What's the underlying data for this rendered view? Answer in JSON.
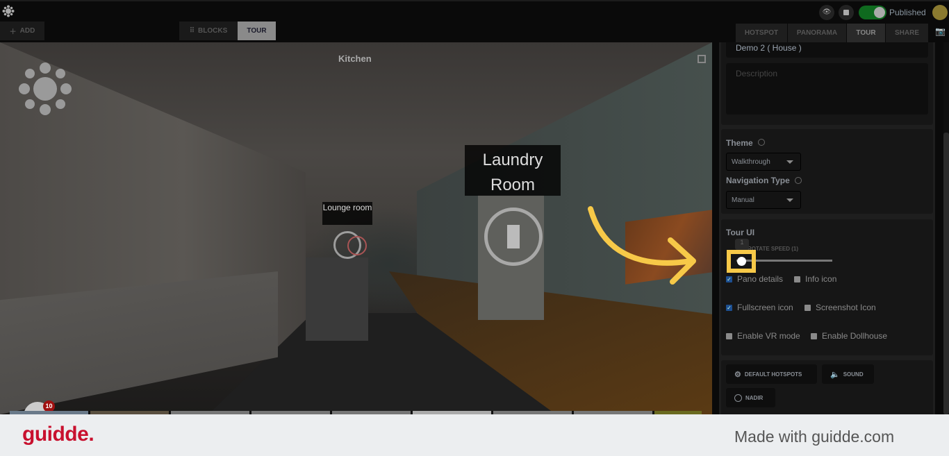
{
  "topbar": {
    "status_label": "Published",
    "toggle_on": true,
    "accent": "#0f6a1f"
  },
  "toolbar": {
    "add_label": "ADD",
    "blocks_label": "BLOCKS",
    "tour_label": "TOUR"
  },
  "right_tabs": [
    {
      "label": "HOTSPOT"
    },
    {
      "label": "PANORAMA"
    },
    {
      "label": "TOUR",
      "active": true
    },
    {
      "label": "SHARE"
    }
  ],
  "pano": {
    "title": "Kitchen",
    "hotspots": [
      {
        "label": "Lounge room"
      },
      {
        "label": "Laundry Room"
      }
    ],
    "badge": "10"
  },
  "panel": {
    "tour_name": "Demo 2 ( House )",
    "description_placeholder": "Description",
    "theme_label": "Theme",
    "theme_value": "Walkthrough",
    "nav_label": "Navigation Type",
    "nav_value": "Manual",
    "tour_ui_label": "Tour UI",
    "speed_label": "ROTATE SPEED (1)",
    "speed_tooltip": "1",
    "speed_value": 1,
    "checkboxes": [
      {
        "label": "Pano details",
        "checked": true
      },
      {
        "label": "Info icon",
        "checked": false
      },
      {
        "label": "Fullscreen icon",
        "checked": true
      },
      {
        "label": "Screenshot Icon",
        "checked": false
      },
      {
        "label": "Enable VR mode",
        "checked": false
      },
      {
        "label": "Enable Dollhouse",
        "checked": false
      }
    ],
    "buttons": {
      "default_hotspots": "DEFAULT HOTSPOTS",
      "sound": "SOUND",
      "nadir": "NADIR"
    }
  },
  "footer": {
    "brand": "guidde.",
    "tagline": "Made with guidde.com",
    "brand_color": "#c8102e"
  },
  "highlight_color": "#f7c948"
}
